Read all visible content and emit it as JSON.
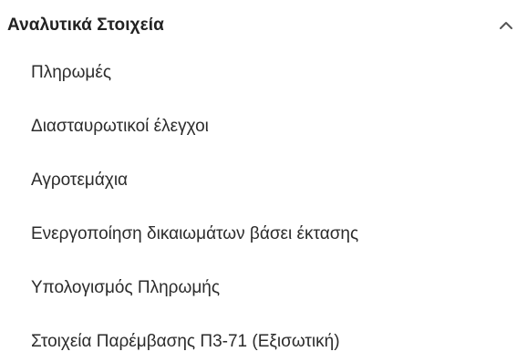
{
  "section": {
    "title": "Αναλυτικά Στοιχεία",
    "toggle_icon": "chevron-up-icon",
    "expanded": true
  },
  "items": [
    {
      "label": "Πληρωμές"
    },
    {
      "label": "Διασταυρωτικοί έλεγχοι"
    },
    {
      "label": "Αγροτεμάχια"
    },
    {
      "label": "Ενεργοποίηση δικαιωμάτων βάσει έκτασης"
    },
    {
      "label": "Υπολογισμός Πληρωμής"
    },
    {
      "label": "Στοιχεία Παρέμβασης Π3-71 (Εξισωτική)"
    }
  ],
  "colors": {
    "text": "#2b2b2b",
    "title": "#222222",
    "chevron": "#555555",
    "background": "#ffffff"
  }
}
